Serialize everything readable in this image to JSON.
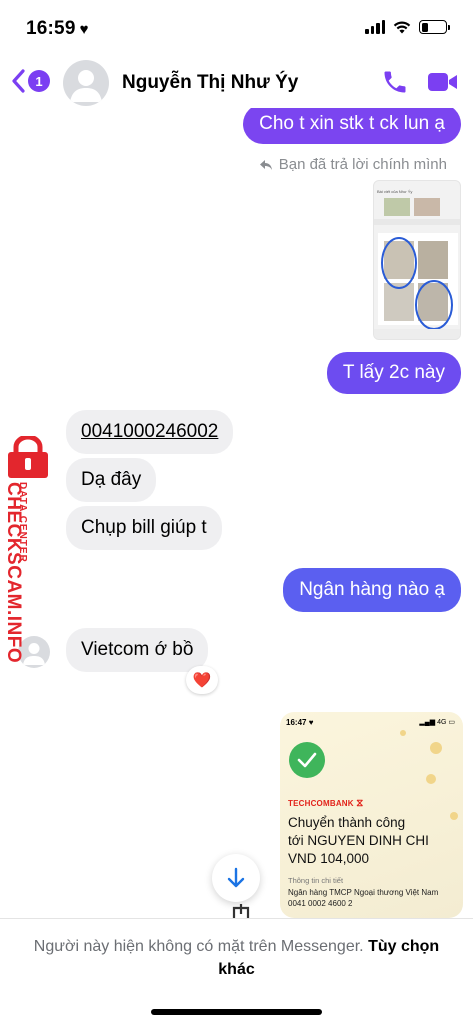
{
  "status_bar": {
    "time": "16:59",
    "battery_level": 0.3
  },
  "header": {
    "back_badge": "1",
    "contact_name": "Nguyễn Thị Như Ýy",
    "accent_color": "#7b3ff2"
  },
  "messages": {
    "out_1": "Cho t xin stk t ck lun ạ",
    "reply_note": "Bạn đã trả lời chính mình",
    "out_2": "T lấy 2c này",
    "in_1": "0041000246002",
    "in_2": "Dạ đây",
    "in_3": "Chụp bill giúp t",
    "out_3": "Ngân hàng nào ạ",
    "in_4": "Vietcom ớ bồ",
    "reaction": "❤️"
  },
  "thumbnail": {
    "title": "Bài viết của Như Ýy"
  },
  "receipt": {
    "time": "16:47",
    "network": "4G",
    "brand": "TECHCOMBANK",
    "title_line1": "Chuyển thành công",
    "title_line2": "tới NGUYEN DINH CHI",
    "title_line3": "VND 104,000",
    "details_label": "Thông tin chi tiết",
    "bank_name": "Ngân hàng TMCP Ngoại thương Việt Nam",
    "account": "0041 0002 4600 2"
  },
  "watermark": {
    "line1": "DATA CENTER",
    "line2": "CHECKSCAM.INFO"
  },
  "footer": {
    "notice": "Người này hiện không có mặt trên Messenger.",
    "link": "Tùy chọn khác"
  },
  "colors": {
    "bubble_purple": "#7b45f0",
    "bubble_blue": "#5b5ff0",
    "incoming": "#efeff1"
  }
}
